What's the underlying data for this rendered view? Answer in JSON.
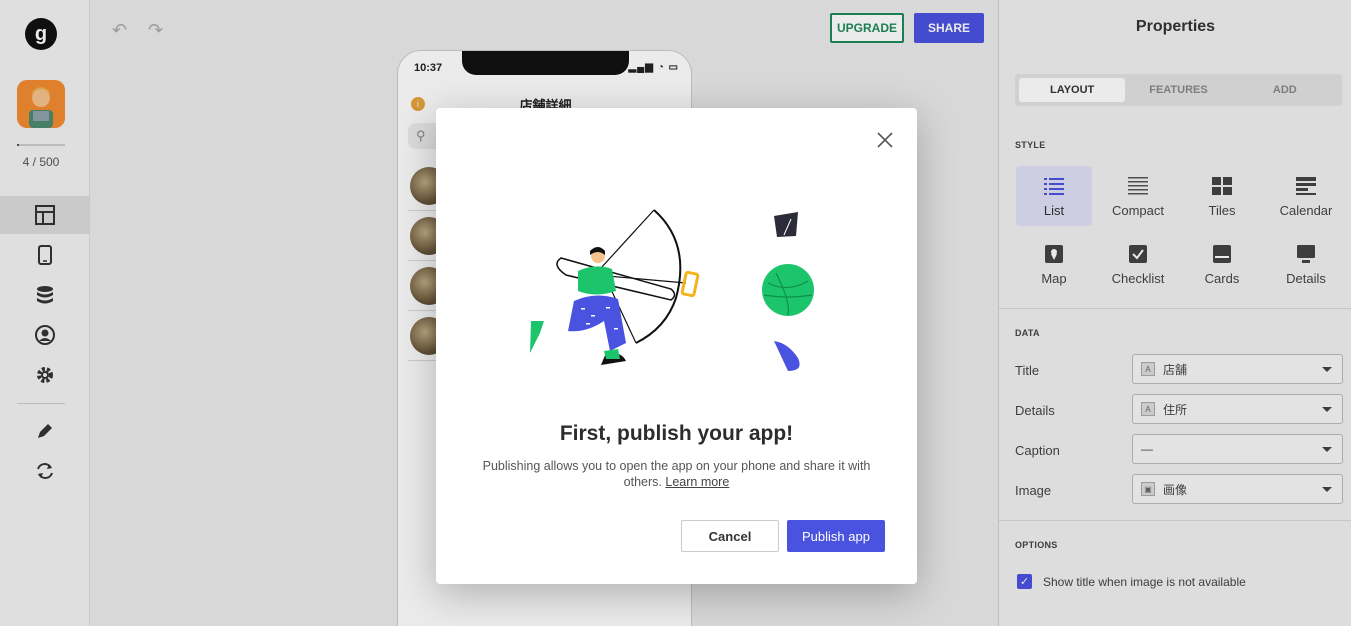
{
  "rail": {
    "logo_letter": "g",
    "rows_count": "4 / 500",
    "rows_used_fraction": 0.008
  },
  "toolbar": {
    "upgrade_label": "UPGRADE",
    "share_label": "SHARE"
  },
  "phone": {
    "time": "10:37",
    "title": "店舗詳細",
    "info_glyph": "i"
  },
  "properties": {
    "title": "Properties",
    "tabs": [
      "LAYOUT",
      "FEATURES",
      "ADD"
    ],
    "active_tab": "LAYOUT",
    "style_section": "STYLE",
    "styles": [
      "List",
      "Compact",
      "Tiles",
      "Calendar",
      "Map",
      "Checklist",
      "Cards",
      "Details"
    ],
    "active_style": "List",
    "data_section": "DATA",
    "fields": [
      {
        "label": "Title",
        "value": "店舗"
      },
      {
        "label": "Details",
        "value": "住所"
      },
      {
        "label": "Caption",
        "value": "—"
      },
      {
        "label": "Image",
        "value": "画像"
      }
    ],
    "options_section": "OPTIONS",
    "option_checkbox_label": "Show title when image is not available",
    "option_checked": true
  },
  "modal": {
    "title": "First, publish your app!",
    "description": "Publishing allows you to open the app on your phone and share it with others.",
    "learn_more": "Learn more",
    "cancel_label": "Cancel",
    "publish_label": "Publish app"
  },
  "colors": {
    "accent": "#4a52e0",
    "upgrade": "#1f8a5a",
    "illustration_green": "#1cc46b",
    "illustration_blue": "#4a52e0"
  }
}
